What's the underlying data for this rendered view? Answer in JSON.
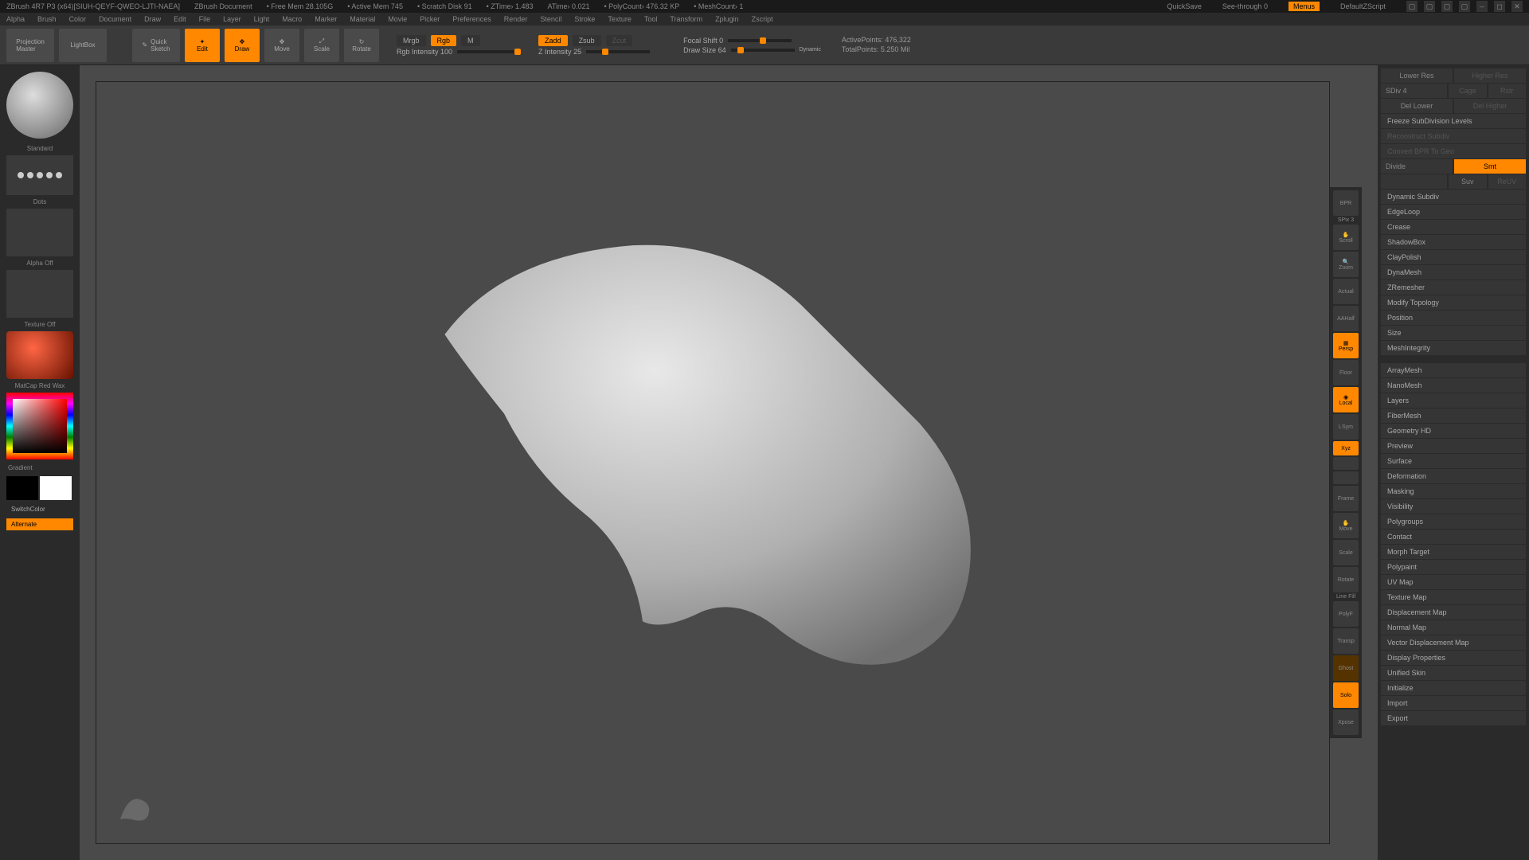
{
  "title": {
    "app": "ZBrush 4R7 P3 (x64)[SIUH-QEYF-QWEO-LJTI-NAEA]",
    "doc": "ZBrush Document",
    "freemem": "• Free Mem 28.105G",
    "activemem": "• Active Mem 745",
    "scratch": "• Scratch Disk 91",
    "ztime": "• ZTime› 1.483",
    "atime": "ATime› 0.021",
    "polycount": "• PolyCount› 476.32 KP",
    "meshcount": "• MeshCount› 1",
    "quicksave": "QuickSave",
    "seethrough": "See-through   0",
    "menus": "Menus",
    "script": "DefaultZScript"
  },
  "menu": {
    "items": [
      "Alpha",
      "Brush",
      "Color",
      "Document",
      "Draw",
      "Edit",
      "File",
      "Layer",
      "Light",
      "Macro",
      "Marker",
      "Material",
      "Movie",
      "Picker",
      "Preferences",
      "Render",
      "Stencil",
      "Stroke",
      "Texture",
      "Tool",
      "Transform",
      "Zplugin",
      "Zscript"
    ]
  },
  "toolbar": {
    "projection": "Projection\nMaster",
    "lightbox": "LightBox",
    "quicksketch": "Quick\nSketch",
    "edit": "Edit",
    "draw": "Draw",
    "move": "Move",
    "scale": "Scale",
    "rotate": "Rotate",
    "mrgb": "Mrgb",
    "rgb": "Rgb",
    "m": "M",
    "rgbintensity": "Rgb Intensity 100",
    "zadd": "Zadd",
    "zsub": "Zsub",
    "zcut": "Zcut",
    "zintensity": "Z Intensity 25",
    "focalshift": "Focal Shift 0",
    "drawsize": "Draw Size 64",
    "dynamic": "Dynamic",
    "activepoints": "ActivePoints: 476,322",
    "totalpoints": "TotalPoints: 5.250 Mil"
  },
  "left": {
    "brush": "Standard",
    "stroke": "Dots",
    "alpha": "Alpha Off",
    "texture": "Texture Off",
    "material": "MatCap Red Wax",
    "gradient": "Gradient",
    "switchcolor": "SwitchColor",
    "alternate": "Alternate"
  },
  "rightbar": {
    "spix": "SPix 3",
    "items": [
      "BPR",
      "Scroll",
      "Zoom",
      "Actual",
      "AAHalf",
      "Persp",
      "Floor",
      "Local",
      "LSym",
      "Xyz",
      "Frame",
      "Move",
      "Scale",
      "Rotate",
      "PolyF",
      "Transp",
      "Ghost",
      "Solo",
      "Xpose"
    ],
    "linefill": "Line Fill"
  },
  "panel": {
    "lowerres": "Lower Res",
    "higherres": "Higher Res",
    "sdiv": "SDiv 4",
    "cage": "Cage",
    "rstr": "Rstr",
    "dellower": "Del Lower",
    "delhigher": "Del Higher",
    "freeze": "Freeze SubDivision Levels",
    "reconstruct": "Reconstruct Subdiv",
    "convert": "Convert BPR To Geo",
    "divide": "Divide",
    "smt": "Smt",
    "suv": "Suv",
    "reuv": "ReUV",
    "sections": [
      "Dynamic Subdiv",
      "EdgeLoop",
      "Crease",
      "ShadowBox",
      "ClayPolish",
      "DynaMesh",
      "ZRemesher",
      "Modify Topology",
      "Position",
      "Size",
      "MeshIntegrity"
    ],
    "tools": [
      "ArrayMesh",
      "NanoMesh",
      "Layers",
      "FiberMesh",
      "Geometry HD",
      "Preview",
      "Surface",
      "Deformation",
      "Masking",
      "Visibility",
      "Polygroups",
      "Contact",
      "Morph Target",
      "Polypaint",
      "UV Map",
      "Texture Map",
      "Displacement Map",
      "Normal Map",
      "Vector Displacement Map",
      "Display Properties",
      "Unified Skin",
      "Initialize",
      "Import",
      "Export"
    ]
  }
}
